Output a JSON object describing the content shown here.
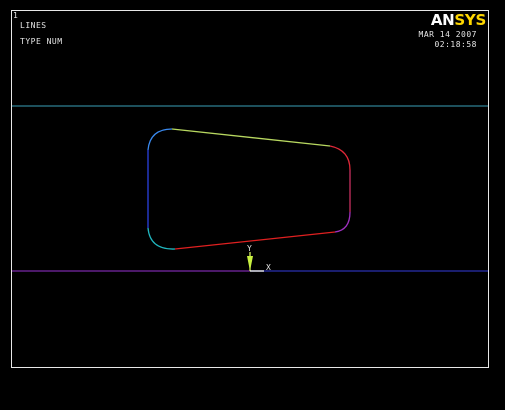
{
  "window": {
    "number": "1",
    "plot_type": "LINES",
    "numbering": "TYPE NUM"
  },
  "logo": {
    "part1": "AN",
    "part2": "SYS"
  },
  "timestamp": {
    "date": "MAR 14 2007",
    "time": "02:18:58"
  },
  "triad": {
    "x_label": "X",
    "y_label": "Y"
  },
  "colors": {
    "background": "#000000",
    "frame": "#e8e8e8",
    "top_line": "#3aa0b8",
    "bottom_line": "#6a2aa8",
    "shape_top": "#b8d860",
    "shape_bottom": "#e02020",
    "shape_left": "#2a40e0",
    "shape_right": "#e03040"
  }
}
